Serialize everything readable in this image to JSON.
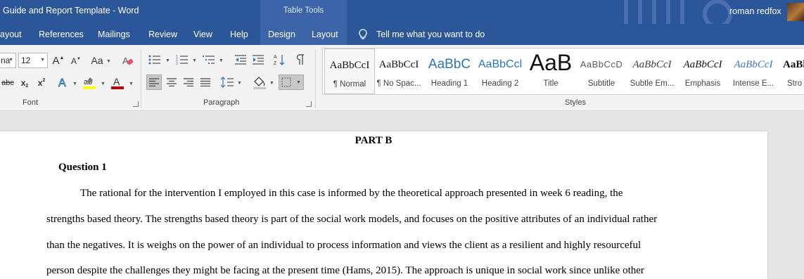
{
  "titlebar": {
    "title": "Guide and Report Template  -  Word",
    "context_tab_group": "Table Tools",
    "user": "roman redfox"
  },
  "tabs": [
    {
      "label": "ayout"
    },
    {
      "label": "References"
    },
    {
      "label": "Mailings"
    },
    {
      "label": "Review"
    },
    {
      "label": "View"
    },
    {
      "label": "Help"
    },
    {
      "label": "Design"
    },
    {
      "label": "Layout"
    }
  ],
  "tell_me": "Tell me what you want to do",
  "font": {
    "family_value": "na",
    "size_value": "12",
    "grow_label": "A",
    "shrink_label": "A",
    "case_label": "Aa",
    "strike_label": "abc",
    "subscript_label": "x",
    "superscript_label": "x",
    "group_label": "Font"
  },
  "paragraph": {
    "group_label": "Paragraph"
  },
  "styles": {
    "group_label": "Styles",
    "items": [
      {
        "preview": "AaBbCcI",
        "name": "¶ Normal"
      },
      {
        "preview": "AaBbCcI",
        "name": "¶ No Spac..."
      },
      {
        "preview": "AaBbC",
        "name": "Heading 1"
      },
      {
        "preview": "AaBbCcl",
        "name": "Heading 2"
      },
      {
        "preview": "AaB",
        "name": "Title"
      },
      {
        "preview": "AaBbCcD",
        "name": "Subtitle"
      },
      {
        "preview": "AaBbCcI",
        "name": "Subtle Em..."
      },
      {
        "preview": "AaBbCcI",
        "name": "Emphasis"
      },
      {
        "preview": "AaBbCcI",
        "name": "Intense E..."
      },
      {
        "preview": "AaBl",
        "name": "Stro"
      }
    ]
  },
  "document": {
    "part_title": "PART B",
    "question_title": "Question 1",
    "lines": [
      "The rational for the intervention I employed in this case is informed by the theoretical approach presented in week 6 reading, the",
      "strengths based theory. The strengths based theory is part of the social work models, and focuses on the positive attributes of an individual rather",
      "than the negatives. It is weighs on the power of an individual to process information and views the client as a resilient and highly resourceful",
      "person despite the challenges they might be facing at the present time (Hams, 2015). The approach is unique in social work since unlike other"
    ]
  },
  "colors": {
    "title_bar": "#2b579a",
    "context_tab": "#3c64a8",
    "font_color_underline": "#c00000",
    "highlight_underline": "#ffff00"
  }
}
